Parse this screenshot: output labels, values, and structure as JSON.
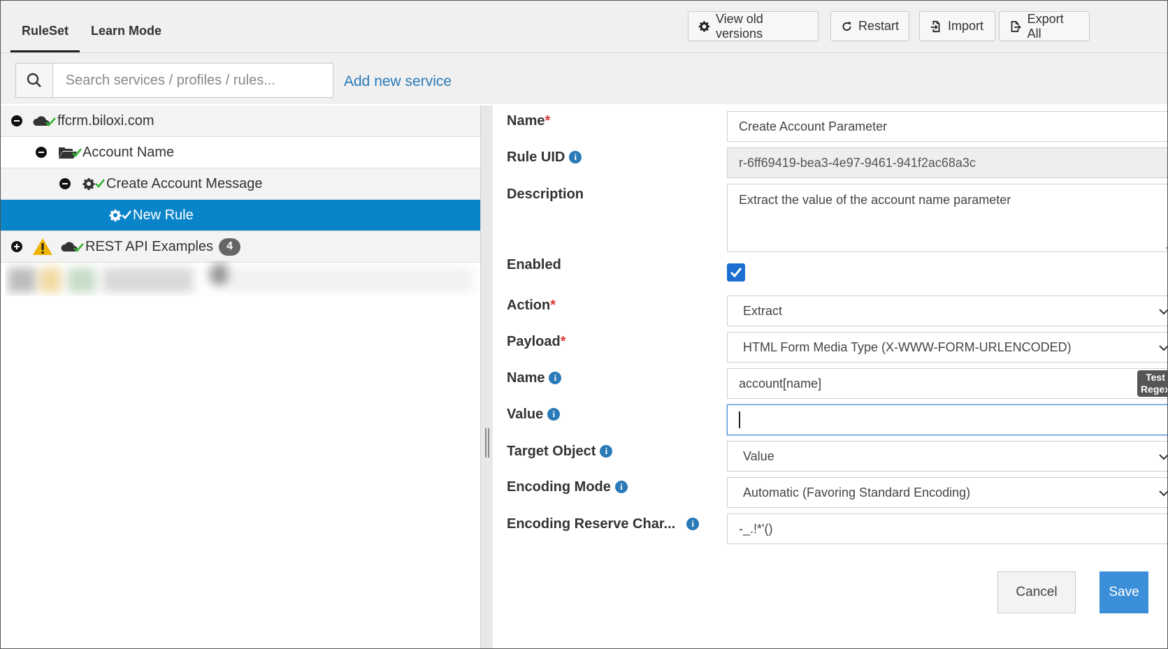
{
  "tabs": [
    {
      "label": "RuleSet",
      "active": true
    },
    {
      "label": "Learn Mode",
      "active": false
    }
  ],
  "toolbar": {
    "view_old_versions": "View old versions",
    "restart": "Restart",
    "import": "Import",
    "export_all": "Export All"
  },
  "search": {
    "placeholder": "Search services / profiles / rules...",
    "add_new_service": "Add new service"
  },
  "tree": {
    "items": [
      {
        "label": "ffcrm.biloxi.com",
        "icon": "cloud-check-icon",
        "expanded": true
      },
      {
        "label": "Account Name",
        "icon": "folder-open-check-icon",
        "expanded": true
      },
      {
        "label": "Create Account Message",
        "icon": "gear-check-icon",
        "expanded": true
      },
      {
        "label": "New Rule",
        "icon": "gear-check-icon",
        "selected": true
      },
      {
        "label": "REST API Examples",
        "icon": "cloud-check-icon",
        "expanded": false,
        "warning": true,
        "badge": "4"
      }
    ]
  },
  "form": {
    "name_label": "Name",
    "name_value": "Create Account Parameter",
    "rule_uid_label": "Rule UID",
    "rule_uid_value": "r-6ff69419-bea3-4e97-9461-941f2ac68a3c",
    "description_label": "Description",
    "description_value": "Extract the value of the account name parameter",
    "enabled_label": "Enabled",
    "enabled": true,
    "action_label": "Action",
    "action_value": "Extract",
    "payload_label": "Payload",
    "payload_value": "HTML Form Media Type (X-WWW-FORM-URLENCODED)",
    "param_name_label": "Name",
    "param_name_value": "account[name]",
    "test_regex_line1": "Test",
    "test_regex_line2": "Regex",
    "value_label": "Value",
    "value_value": "",
    "target_object_label": "Target Object",
    "target_object_value": "Value",
    "encoding_mode_label": "Encoding Mode",
    "encoding_mode_value": "Automatic (Favoring Standard Encoding)",
    "encoding_reserve_label": "Encoding Reserve Char...",
    "encoding_reserve_value": "-_.!*'()",
    "required_mark": "*",
    "info_glyph": "i",
    "cancel": "Cancel",
    "save": "Save"
  },
  "colors": {
    "accent": "#0a84c9",
    "link": "#2a7ab8",
    "required": "#d9383a",
    "check_green": "#2db32d",
    "warning": "#f0b400"
  }
}
